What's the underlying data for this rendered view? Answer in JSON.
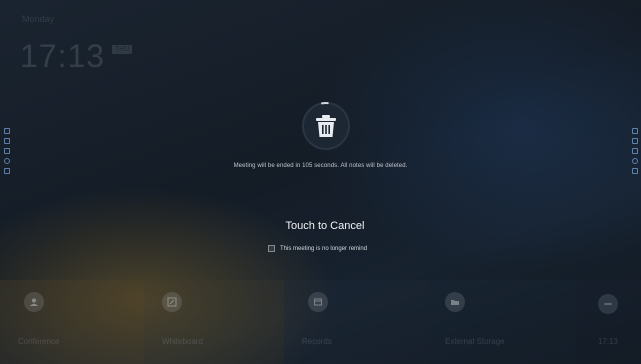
{
  "home": {
    "date": "Monday",
    "time": "17:13",
    "weekday": "THU"
  },
  "side_toolbar": {
    "left_icons": [
      "menu-icon",
      "note-icon",
      "screenshot-icon",
      "pen-icon",
      "back-icon"
    ],
    "right_icons": [
      "menu-icon",
      "note-icon",
      "screenshot-icon",
      "pen-icon",
      "back-icon"
    ]
  },
  "dock": {
    "tiles": [
      {
        "label": "Conference",
        "icon": "conference-icon"
      },
      {
        "label": "Whiteboard",
        "icon": "whiteboard-icon"
      },
      {
        "label": "Records",
        "icon": "records-icon"
      },
      {
        "label": "External Storage",
        "icon": "storage-icon"
      },
      {
        "label": "17:13",
        "icon": "apps-icon"
      }
    ]
  },
  "dialog": {
    "message": "Meeting will be ended in 105 seconds. All notes will be deleted.",
    "cancel_label": "Touch to Cancel",
    "remind_label": "This meeting is no longer remind",
    "remind_checked": false,
    "countdown_fraction": 0.04
  },
  "colors": {
    "ring": "#2a3542",
    "ring_progress": "#cfd6de",
    "trash": "#e8ecf0"
  }
}
